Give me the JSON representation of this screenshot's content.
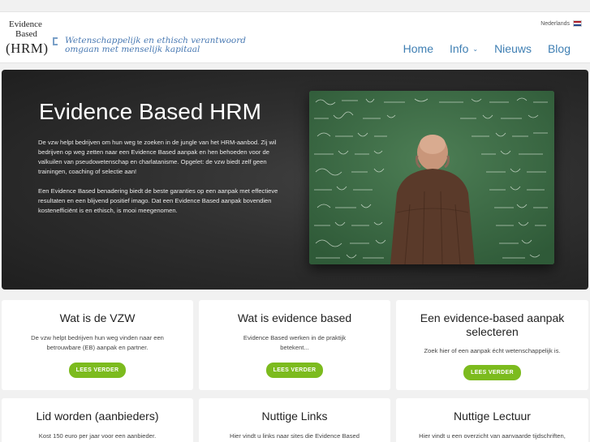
{
  "header": {
    "logo": {
      "line1": "Evidence",
      "line2": "Based",
      "line3": "(HRM)"
    },
    "tagline_line1": "Wetenschappelijk en ethisch verantwoord",
    "tagline_line2": "omgaan met menselijk kapitaal",
    "language": "Nederlands",
    "nav": [
      {
        "label": "Home"
      },
      {
        "label": "Info"
      },
      {
        "label": "Nieuws"
      },
      {
        "label": "Blog"
      }
    ]
  },
  "hero": {
    "title": "Evidence Based HRM",
    "paragraph1": "De vzw helpt bedrijven om hun weg te zoeken in de jungle van het HRM-aanbod. Zij wil bedrijven op weg zetten naar een Evidence Based aanpak en hen behoeden voor de valkuilen van pseudowetenschap en charlatanisme. Opgelet: de vzw biedt zelf geen trainingen, coaching of selectie aan!",
    "paragraph2": "Een Evidence Based benadering biedt de beste garanties op een aanpak met effectieve resultaten en een blijvend positief imago. Dat een Evidence Based aanpak bovendien kostenefficiënt is en ethisch, is mooi meegenomen."
  },
  "cards": [
    {
      "title": "Wat is de VZW",
      "text": "De vzw helpt bedrijven hun weg vinden naar een betrouwbare (EB) aanpak en partner.",
      "button": "LEES VERDER"
    },
    {
      "title": "Wat is evidence based",
      "text": "Evidence Based werken in de praktijk betekent...",
      "button": "LEES VERDER"
    },
    {
      "title": "Een evidence-based aanpak selecteren",
      "text": "Zoek hier of een aanpak écht wetenschappelijk is.",
      "button": "LEES VERDER"
    },
    {
      "title": "Lid worden (aanbieders)",
      "text": "Kost 150 euro per jaar voor een aanbieder."
    },
    {
      "title": "Nuttige Links",
      "text": "Hier vindt u links naar sites die Evidence Based"
    },
    {
      "title": "Nuttige Lectuur",
      "text": "Hier vindt u een overzicht van aanvaarde tijdschriften,"
    }
  ],
  "colors": {
    "nav": "#3f7fb3",
    "button": "#7cbb1e",
    "hero_bg": "#2f2f2f"
  }
}
